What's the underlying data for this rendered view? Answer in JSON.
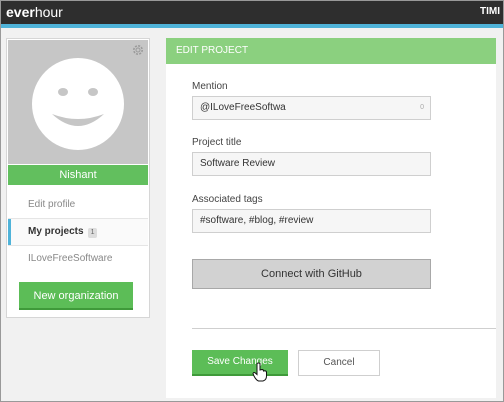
{
  "header": {
    "brand_bold": "ever",
    "brand_rest": "hour",
    "user": "TIMI"
  },
  "profile": {
    "name": "Nishant",
    "menu": [
      {
        "label": "Edit profile"
      },
      {
        "label": "My projects",
        "badge": "1"
      },
      {
        "label": "ILoveFreeSoftware"
      }
    ],
    "new_org_label": "New organization"
  },
  "edit_project": {
    "title": "EDIT PROJECT",
    "mention_label": "Mention",
    "mention_value": "@ILoveFreeSoftwa",
    "mention_counter": "0",
    "project_title_label": "Project title",
    "project_title_value": "Software Review",
    "tags_label": "Associated tags",
    "tags_value": "#software, #blog, #review",
    "github_label": "Connect with GitHub",
    "save_label": "Save Changes",
    "cancel_label": "Cancel"
  },
  "colors": {
    "green": "#5cbd57",
    "header_green": "#8bd07f",
    "topbar": "#2e2e2e",
    "accent_blue": "#4fb3d9"
  }
}
